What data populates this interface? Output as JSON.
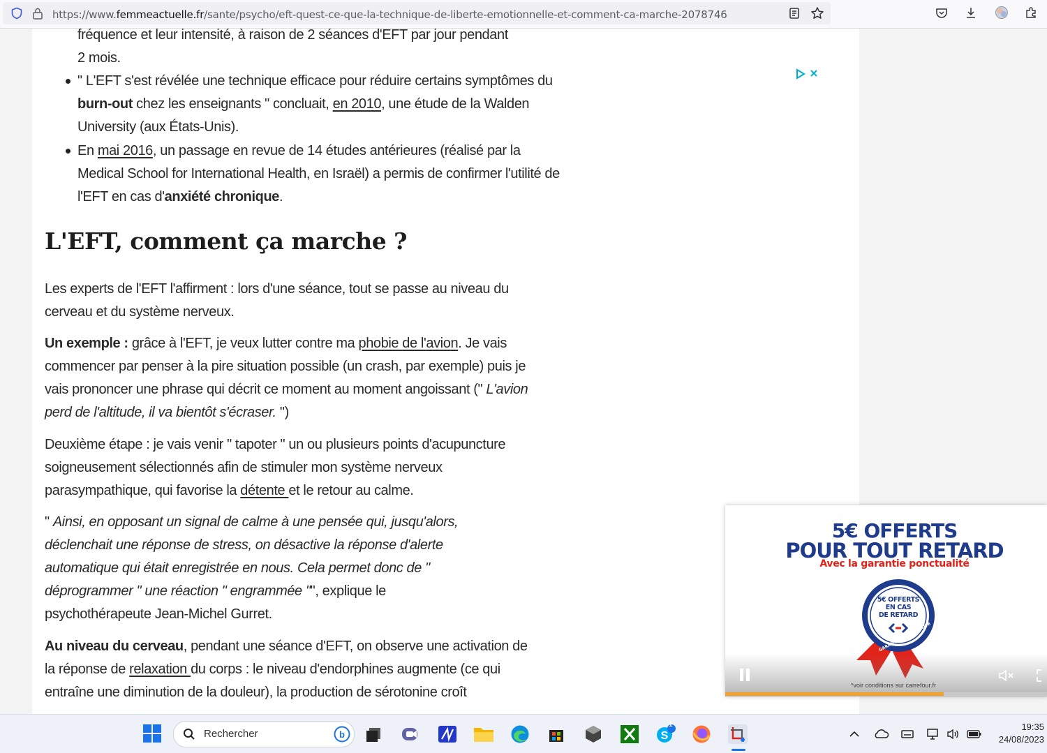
{
  "browser": {
    "url_prefix": "https://www.",
    "url_domain": "femmeactuelle.fr",
    "url_path": "/sante/psycho/eft-quest-ce-que-la-technique-de-liberte-emotionnelle-et-comment-ca-marche-2078746"
  },
  "article": {
    "top_line1": "fréquence et leur intensité, à raison de 2 séances d'EFT par jour pendant",
    "top_line2": "2 mois.",
    "b1_a": "\" L'EFT s'est révélée une technique efficace pour réduire certains symptômes du ",
    "b1_bold": "burn-out",
    "b1_b": " chez les enseignants \" concluait, ",
    "b1_link": "en 2010",
    "b1_c": ", une étude de la Walden University (aux États-Unis).",
    "b2_a": "En ",
    "b2_link": "mai 2016",
    "b2_b": ", un passage en revue de 14 études antérieures (réalisé par la Medical School for International Health, en Israël) a permis de confirmer l'utilité de l'EFT en cas d'",
    "b2_bold": "anxiété chronique",
    "b2_c": ".",
    "heading": "L'EFT, comment ça marche ?",
    "p1": "Les experts de l'EFT l'affirment : lors d'une séance, tout se passe au niveau du cerveau et du système nerveux.",
    "p2_bold": "Un exemple :",
    "p2_a": " grâce à l'EFT, je veux lutter contre ma ",
    "p2_link": "phobie de l'avion",
    "p2_b": ". Je vais commencer par penser à la pire situation possible (un crash, par exemple) puis je vais prononcer une phrase qui décrit ce moment au moment angoissant (\" ",
    "p2_italic": "L'avion perd de l'altitude, il va bientôt s'écraser.",
    "p2_c": " \")",
    "p3_a": "Deuxième étape : je vais venir \" tapoter \" un ou plusieurs points d'acupuncture soigneusement sélectionnés afin de stimuler mon système nerveux parasympathique, qui favorise la ",
    "p3_link": "détente ",
    "p3_b": "et le retour au calme.",
    "p4_a": "\" ",
    "p4_italic": "Ainsi, en opposant un signal de calme à une pensée qui, jusqu'alors, déclenchait une réponse de stress, on désactive la réponse d'alerte automatique qui était enregistrée en nous. Cela permet donc de \" déprogrammer \" une réaction \" engrammée \"",
    "p4_b": "\", explique le psychothérapeute Jean-Michel Gurret.",
    "p5_bold": "Au niveau du cerveau",
    "p5_a": ", pendant une séance d'EFT, on observe une activation de la réponse de ",
    "p5_link": "relaxation ",
    "p5_b": "du corps : le niveau d'endorphines augmente (ce qui entraîne une diminution de la douleur), la production de sérotonine croît"
  },
  "ad": {
    "line1": "5€ OFFERTS",
    "line2": "POUR TOUT RETARD",
    "sub": "Avec la garantie ponctualité",
    "badge1": "5€ OFFERTS",
    "badge2": "EN CAS",
    "badge3": "DE RETARD",
    "badge_ring": "GARANTIE PONCTUALITÉ",
    "note": "*voir conditions sur carrefour.fr",
    "progress": 0.68
  },
  "taskbar": {
    "search_placeholder": "Rechercher",
    "skype_badge": "1",
    "time": "19:35",
    "date": "24/08/2023"
  }
}
